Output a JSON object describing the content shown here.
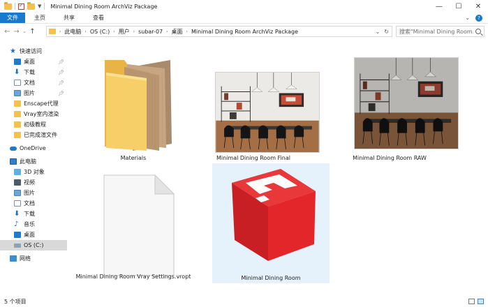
{
  "window": {
    "title": "Minimal Dining Room ArchViz Package",
    "controls": [
      "minimize",
      "maximize",
      "close"
    ]
  },
  "ribbon": {
    "tabs": [
      {
        "label": "文件",
        "active": true
      },
      {
        "label": "主页"
      },
      {
        "label": "共享"
      },
      {
        "label": "查看"
      }
    ]
  },
  "address": {
    "crumbs": [
      "此电脑",
      "OS (C:)",
      "用户",
      "subar-07",
      "桌面",
      "Minimal Dining Room ArchViz Package"
    ]
  },
  "search": {
    "placeholder": "搜索\"Minimal Dining Room..."
  },
  "nav": {
    "quick_access_label": "快速访问",
    "quick_access": [
      {
        "label": "桌面",
        "icon": "desktop-icon",
        "pinned": true
      },
      {
        "label": "下载",
        "icon": "download-icon",
        "pinned": true
      },
      {
        "label": "文档",
        "icon": "document-icon",
        "pinned": true
      },
      {
        "label": "图片",
        "icon": "picture-icon",
        "pinned": true
      },
      {
        "label": "Enscape代理",
        "icon": "folder-icon"
      },
      {
        "label": "Vray室内渲染",
        "icon": "folder-icon"
      },
      {
        "label": "初级教程",
        "icon": "folder-icon"
      },
      {
        "label": "已完成渲文件",
        "icon": "folder-icon"
      }
    ],
    "onedrive_label": "OneDrive",
    "this_pc_label": "此电脑",
    "this_pc": [
      {
        "label": "3D 对象",
        "icon": "3d-objects-icon"
      },
      {
        "label": "视频",
        "icon": "video-icon"
      },
      {
        "label": "图片",
        "icon": "picture-icon"
      },
      {
        "label": "文档",
        "icon": "document-icon"
      },
      {
        "label": "下载",
        "icon": "download-icon"
      },
      {
        "label": "音乐",
        "icon": "music-icon"
      },
      {
        "label": "桌面",
        "icon": "desktop-icon"
      },
      {
        "label": "OS (C:)",
        "icon": "drive-icon",
        "selected": true
      }
    ],
    "network_label": "网络"
  },
  "files": [
    {
      "name": "Materials",
      "kind": "folder"
    },
    {
      "name": "Minimal Dining Room Final",
      "kind": "image"
    },
    {
      "name": "Minimal Dining Room RAW",
      "kind": "image"
    },
    {
      "name": "Minimal Dining Room Vray Settings.vropt",
      "kind": "file"
    },
    {
      "name": "Minimal Dining Room",
      "kind": "sketchup",
      "selected": true
    }
  ],
  "status": {
    "item_count": "5 个项目"
  },
  "colors": {
    "accent": "#1979ca",
    "selection": "#e5f1fb",
    "sketchup_red": "#e3262a"
  }
}
